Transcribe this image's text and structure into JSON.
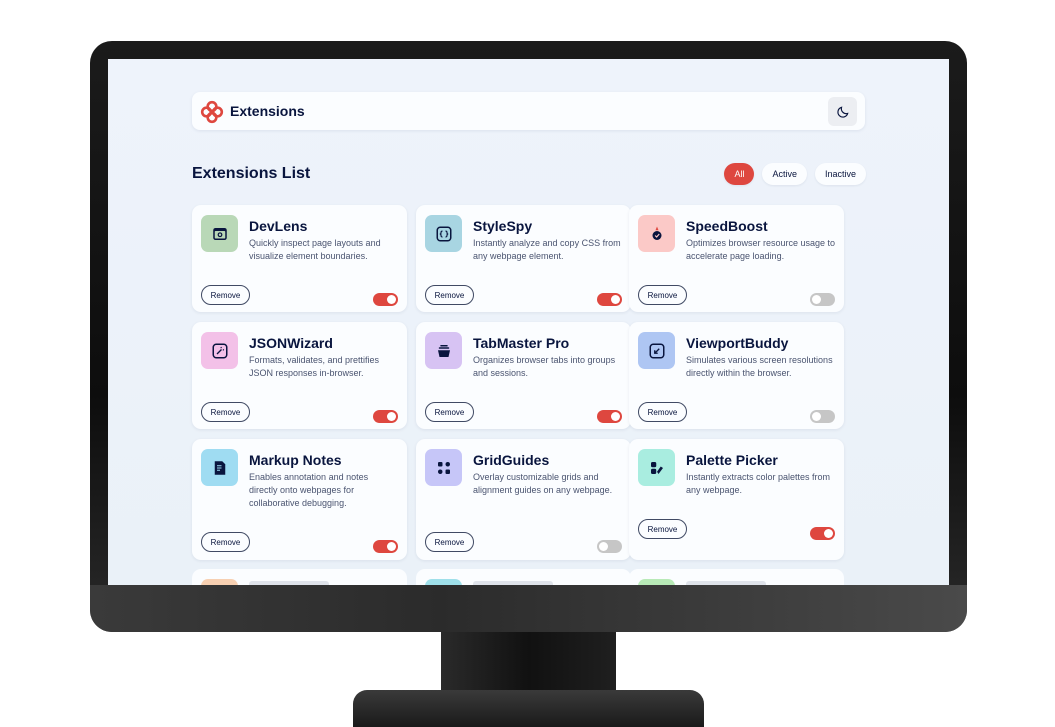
{
  "header": {
    "brand": "Extensions",
    "theme_icon": "moon-icon",
    "logo_icon": "extensions-logo-icon"
  },
  "list": {
    "title": "Extensions List"
  },
  "filters": [
    {
      "label": "All",
      "active": true
    },
    {
      "label": "Active",
      "active": false
    },
    {
      "label": "Inactive",
      "active": false
    }
  ],
  "remove_label": "Remove",
  "extensions": [
    {
      "name": "DevLens",
      "description": "Quickly inspect page layouts and visualize element boundaries.",
      "enabled": true,
      "icon": "devtools-icon",
      "icon_bg": "#b9d8b7"
    },
    {
      "name": "StyleSpy",
      "description": "Instantly analyze and copy CSS from any webpage element.",
      "enabled": true,
      "icon": "braces-icon",
      "icon_bg": "#a8d5e2"
    },
    {
      "name": "SpeedBoost",
      "description": "Optimizes browser resource usage to accelerate page loading.",
      "enabled": false,
      "icon": "rocket-icon",
      "icon_bg": "#fbc9c7"
    },
    {
      "name": "JSONWizard",
      "description": "Formats, validates, and prettifies JSON responses in-browser.",
      "enabled": true,
      "icon": "wand-icon",
      "icon_bg": "#f3c1e8"
    },
    {
      "name": "TabMaster Pro",
      "description": "Organizes browser tabs into groups and sessions.",
      "enabled": true,
      "icon": "tabs-icon",
      "icon_bg": "#d7c3f3"
    },
    {
      "name": "ViewportBuddy",
      "description": "Simulates various screen resolutions directly within the browser.",
      "enabled": false,
      "icon": "resize-icon",
      "icon_bg": "#aec6f3"
    },
    {
      "name": "Markup Notes",
      "description": "Enables annotation and notes directly onto webpages for collaborative debugging.",
      "enabled": true,
      "icon": "notes-icon",
      "icon_bg": "#9fdcf2"
    },
    {
      "name": "GridGuides",
      "description": "Overlay customizable grids and alignment guides on any webpage.",
      "enabled": false,
      "icon": "grid-icon",
      "icon_bg": "#c6c6f8"
    },
    {
      "name": "Palette Picker",
      "description": "Instantly extracts color palettes from any webpage.",
      "enabled": true,
      "icon": "palette-icon",
      "icon_bg": "#a9ede0"
    }
  ],
  "colors": {
    "accent": "#de473f",
    "text": "#09153e",
    "screen_bg": "#eef3fb"
  }
}
